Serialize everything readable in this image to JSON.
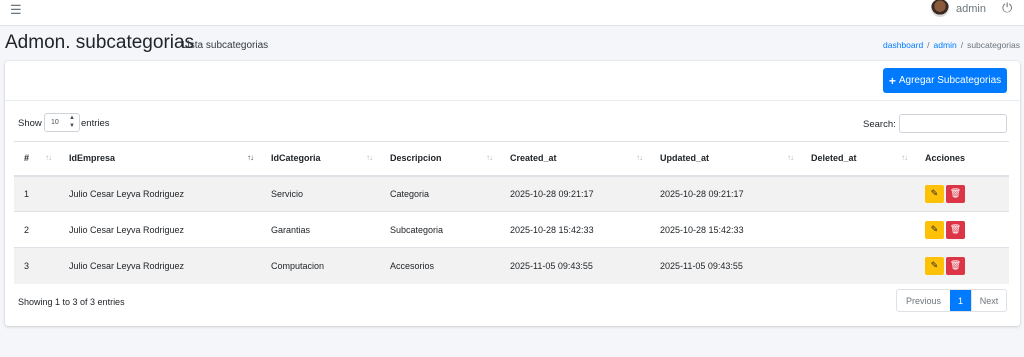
{
  "topbar": {
    "menu_icon": "hamburger-icon",
    "username": "admin",
    "logout_icon": "power-icon"
  },
  "header": {
    "title": "Admon. subcategorias",
    "subtitle": "Lista subcategorias",
    "breadcrumb": [
      "dashboard",
      "admin",
      "subcategorias"
    ]
  },
  "toolbar": {
    "add_label": "Agregar Subcategorias"
  },
  "table_controls": {
    "show_label": "Show",
    "page_size": "10",
    "entries_label": "entries",
    "search_label": "Search:",
    "search_value": ""
  },
  "table": {
    "columns": [
      "#",
      "IdEmpresa",
      "IdCategoria",
      "Descripcion",
      "Created_at",
      "Updated_at",
      "Deleted_at",
      "Acciones"
    ],
    "rows": [
      [
        "1",
        "Julio Cesar Leyva Rodriguez",
        "Servicio",
        "Categoria",
        "2025-10-28 09:21:17",
        "2025-10-28 09:21:17",
        ""
      ],
      [
        "2",
        "Julio Cesar Leyva Rodriguez",
        "Garantias",
        "Subcategoria",
        "2025-10-28 15:42:33",
        "2025-10-28 15:42:33",
        ""
      ],
      [
        "3",
        "Julio Cesar Leyva Rodriguez",
        "Computacion",
        "Accesorios",
        "2025-11-05 09:43:55",
        "2025-11-05 09:43:55",
        ""
      ]
    ]
  },
  "footer": {
    "info": "Showing 1 to 3 of 3 entries",
    "previous": "Previous",
    "current_page": "1",
    "next": "Next"
  },
  "colors": {
    "primary": "#007bff",
    "warning": "#ffc107",
    "danger": "#dc3545"
  }
}
